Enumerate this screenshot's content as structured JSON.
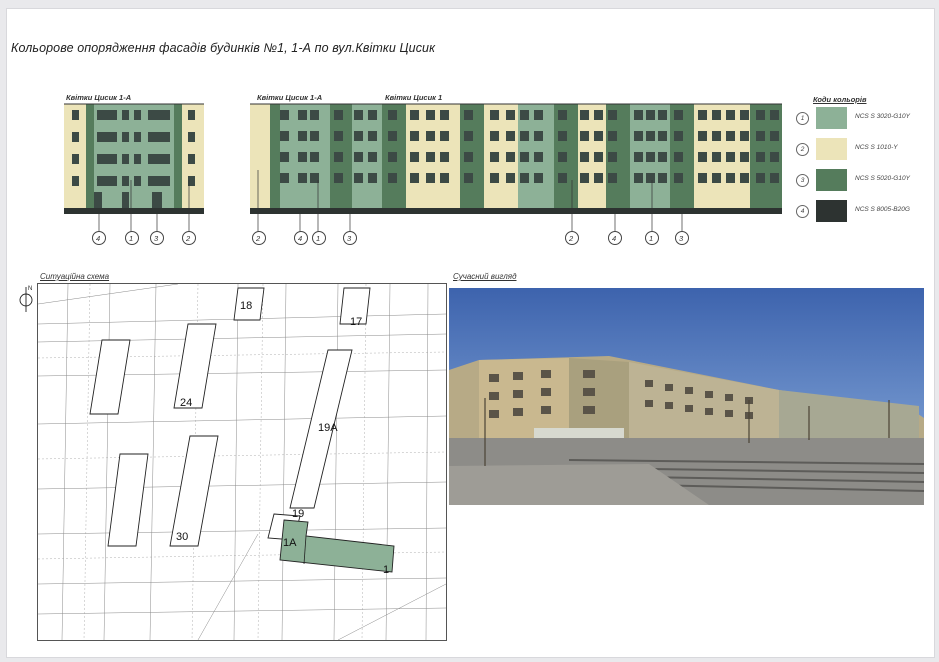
{
  "title": "Кольорове опорядження фасадів будинків №1, 1-А по вул.Квітки Цисик",
  "facade_labels": {
    "left": "Квітки Цисик 1-А",
    "right_a": "Квітки Цисик 1-А",
    "right_b": "Квітки Цисик 1"
  },
  "callouts": {
    "left": [
      "4",
      "1",
      "3",
      "2"
    ],
    "right_left": [
      "2",
      "4",
      "1",
      "3"
    ],
    "right_right": [
      "2",
      "4",
      "1",
      "3"
    ]
  },
  "legend": {
    "title": "Коди кольорів",
    "items": [
      {
        "num": "1",
        "code": "NCS S 3020-G10Y",
        "color": "#8db197"
      },
      {
        "num": "2",
        "code": "NCS S 1010-Y",
        "color": "#ece4b9"
      },
      {
        "num": "3",
        "code": "NCS S 5020-G10Y",
        "color": "#557c5c"
      },
      {
        "num": "4",
        "code": "NCS S 8005-B20G",
        "color": "#2d3331"
      }
    ]
  },
  "situation_title": "Ситуаційна схема",
  "photo_title": "Сучасний вигляд",
  "map_labels": {
    "b18": "18",
    "b17": "17",
    "b24": "24",
    "b19a": "19A",
    "b30": "30",
    "b19": "19",
    "b1a": "1А",
    "b1": "1"
  },
  "north_label": "N"
}
